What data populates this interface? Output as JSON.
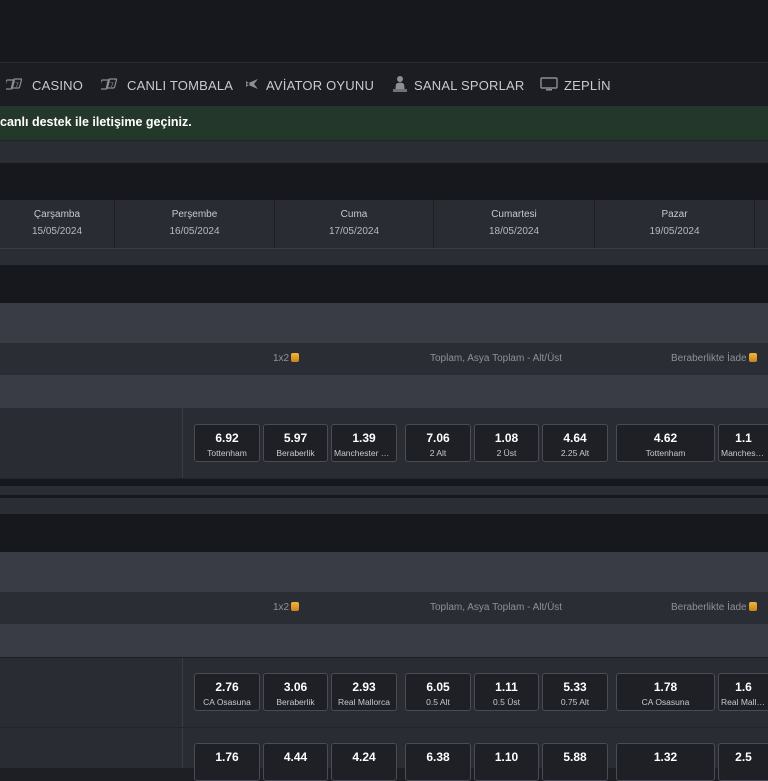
{
  "nav": [
    {
      "label": "CASINO",
      "icon": "cards-icon"
    },
    {
      "label": "CANLI TOMBALA",
      "icon": "cards-icon"
    },
    {
      "label": "AVİATOR OYUNU",
      "icon": "plane-icon"
    },
    {
      "label": "SANAL SPORLAR",
      "icon": "person-icon"
    },
    {
      "label": "ZEPLİN",
      "icon": "monitor-icon"
    }
  ],
  "alert": {
    "text": "canlı destek ile iletişime geçiniz."
  },
  "dates": [
    {
      "day": "Çarşamba",
      "date": "15/05/2024"
    },
    {
      "day": "Perşembe",
      "date": "16/05/2024"
    },
    {
      "day": "Cuma",
      "date": "17/05/2024"
    },
    {
      "day": "Cumartesi",
      "date": "18/05/2024"
    },
    {
      "day": "Pazar",
      "date": "19/05/2024"
    }
  ],
  "market_headers": {
    "one_x_two": "1x2",
    "totals": "Toplam, Asya Toplam - Alt/Üst",
    "draw_no_bet": "Beraberlikte İade"
  },
  "matches": [
    {
      "odds": [
        {
          "value": "6.92",
          "label": "Tottenham"
        },
        {
          "value": "5.97",
          "label": "Beraberlik"
        },
        {
          "value": "1.39",
          "label": "Manchester City"
        },
        {
          "value": "7.06",
          "label": "2 Alt"
        },
        {
          "value": "1.08",
          "label": "2 Üst"
        },
        {
          "value": "4.64",
          "label": "2.25 Alt"
        },
        {
          "value": "4.62",
          "label": "Tottenham"
        },
        {
          "value": "1.1",
          "label": "Manchester City"
        }
      ]
    },
    {
      "odds": [
        {
          "value": "2.76",
          "label": "CA Osasuna"
        },
        {
          "value": "3.06",
          "label": "Beraberlik"
        },
        {
          "value": "2.93",
          "label": "Real Mallorca"
        },
        {
          "value": "6.05",
          "label": "0.5 Alt"
        },
        {
          "value": "1.11",
          "label": "0.5 Üst"
        },
        {
          "value": "5.33",
          "label": "0.75 Alt"
        },
        {
          "value": "1.78",
          "label": "CA Osasuna"
        },
        {
          "value": "1.6",
          "label": "Real Mallorca"
        }
      ]
    },
    {
      "odds": [
        {
          "value": "1.76",
          "label": ""
        },
        {
          "value": "4.44",
          "label": ""
        },
        {
          "value": "4.24",
          "label": ""
        },
        {
          "value": "6.38",
          "label": ""
        },
        {
          "value": "1.10",
          "label": ""
        },
        {
          "value": "5.88",
          "label": ""
        },
        {
          "value": "1.32",
          "label": ""
        },
        {
          "value": "2.5",
          "label": ""
        }
      ]
    }
  ]
}
